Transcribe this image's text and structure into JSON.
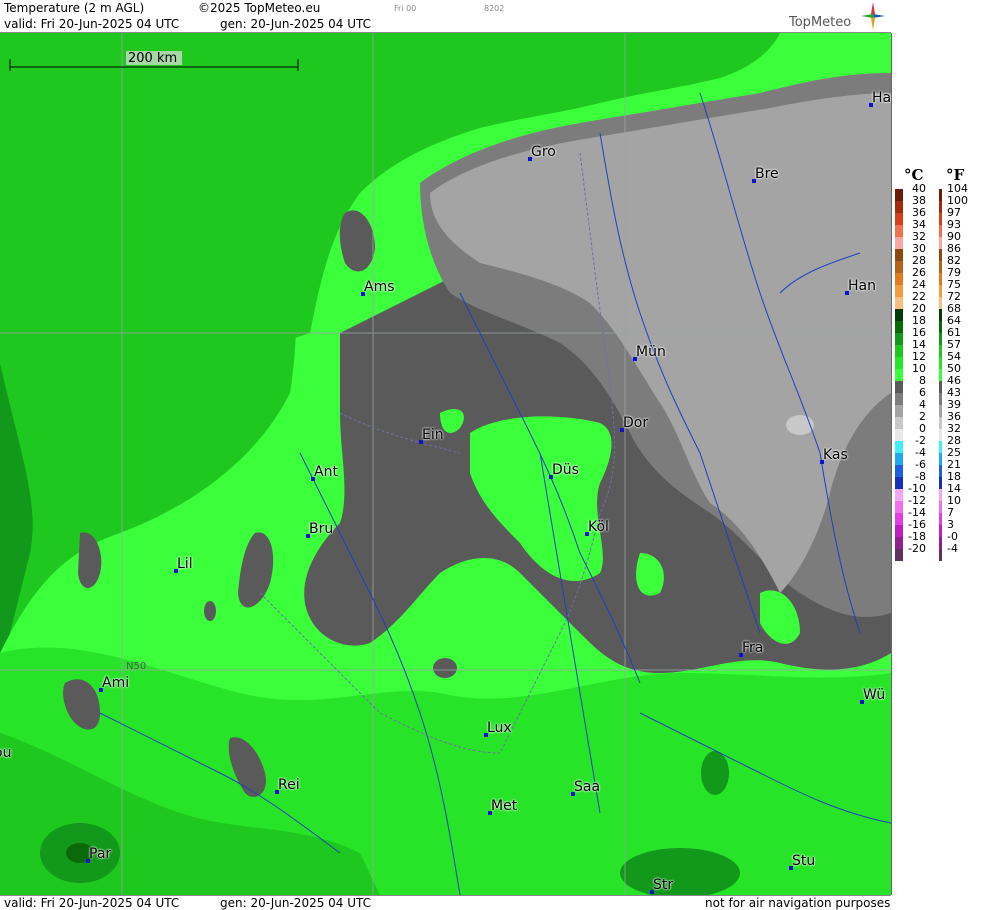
{
  "header": {
    "title": "Temperature (2 m AGL)",
    "copyright": "©2025 TopMeteo.eu",
    "run_code": "Fri 00",
    "run_id": "8202",
    "valid_label": "valid:  Fri  20-Jun-2025  04 UTC",
    "gen_label": "gen:  20-Jun-2025  04 UTC",
    "logo_text": "TopMeteo"
  },
  "footer": {
    "valid_label": "valid:  Fri  20-Jun-2025  04 UTC",
    "gen_label": "gen:  20-Jun-2025  04 UTC",
    "disclaimer": "not for air navigation purposes"
  },
  "map": {
    "scale_label": "200 km",
    "latitude_label": "N50",
    "cities": [
      {
        "name": "Ham"
      },
      {
        "name": "Gro"
      },
      {
        "name": "Bre"
      },
      {
        "name": "Ams"
      },
      {
        "name": "Han"
      },
      {
        "name": "Mün"
      },
      {
        "name": "Ein"
      },
      {
        "name": "Dor"
      },
      {
        "name": "Kas"
      },
      {
        "name": "Ant"
      },
      {
        "name": "Düs"
      },
      {
        "name": "Bru"
      },
      {
        "name": "Köl"
      },
      {
        "name": "Lil"
      },
      {
        "name": "Fra"
      },
      {
        "name": "Ami"
      },
      {
        "name": "Wü"
      },
      {
        "name": "Lux"
      },
      {
        "name": "Rei"
      },
      {
        "name": "Saa"
      },
      {
        "name": "Met"
      },
      {
        "name": "Par"
      },
      {
        "name": "Stu"
      },
      {
        "name": "Str"
      },
      {
        "name": "ou"
      }
    ]
  },
  "legend": {
    "unit_c": "°C",
    "unit_f": "°F",
    "entries": [
      {
        "c": "40",
        "f": "104",
        "color": "#6b1c05"
      },
      {
        "c": "38",
        "f": "100",
        "color": "#a32a0c"
      },
      {
        "c": "36",
        "f": "97",
        "color": "#d4401c"
      },
      {
        "c": "34",
        "f": "93",
        "color": "#f07050"
      },
      {
        "c": "32",
        "f": "90",
        "color": "#f8a8a0"
      },
      {
        "c": "30",
        "f": "86",
        "color": "#8b4a10"
      },
      {
        "c": "28",
        "f": "82",
        "color": "#b86418"
      },
      {
        "c": "26",
        "f": "79",
        "color": "#e07c20"
      },
      {
        "c": "24",
        "f": "75",
        "color": "#f49a40"
      },
      {
        "c": "22",
        "f": "72",
        "color": "#f8c080"
      },
      {
        "c": "20",
        "f": "68",
        "color": "#063a06"
      },
      {
        "c": "18",
        "f": "64",
        "color": "#0a6a0a"
      },
      {
        "c": "16",
        "f": "61",
        "color": "#12981a"
      },
      {
        "c": "14",
        "f": "57",
        "color": "#1ec81e"
      },
      {
        "c": "12",
        "f": "54",
        "color": "#28e428"
      },
      {
        "c": "10",
        "f": "50",
        "color": "#3cff3c"
      },
      {
        "c": "8",
        "f": "46",
        "color": "#5a5a5a"
      },
      {
        "c": "6",
        "f": "43",
        "color": "#7c7c7c"
      },
      {
        "c": "4",
        "f": "39",
        "color": "#a4a4a4"
      },
      {
        "c": "2",
        "f": "36",
        "color": "#c8c8c8"
      },
      {
        "c": "0",
        "f": "32",
        "color": "#e8e8e8"
      },
      {
        "c": "-2",
        "f": "28",
        "color": "#40f0f8"
      },
      {
        "c": "-4",
        "f": "25",
        "color": "#20a8f0"
      },
      {
        "c": "-6",
        "f": "21",
        "color": "#2060e0"
      },
      {
        "c": "-8",
        "f": "18",
        "color": "#1830b8"
      },
      {
        "c": "-10",
        "f": "14",
        "color": "#f4a8f4"
      },
      {
        "c": "-12",
        "f": "10",
        "color": "#f070f0"
      },
      {
        "c": "-14",
        "f": "7",
        "color": "#e040e0"
      },
      {
        "c": "-16",
        "f": "3",
        "color": "#c020c0"
      },
      {
        "c": "-18",
        "f": "-0",
        "color": "#902090"
      },
      {
        "c": "-20",
        "f": "-4",
        "color": "#603060"
      }
    ]
  },
  "colors": {
    "green_bright": "#3cff3c",
    "green_mid": "#28e428",
    "green_dark": "#1ec81e",
    "green_darker": "#12981a",
    "grey_dark": "#5a5a5a",
    "grey_mid": "#7c7c7c",
    "grey_light": "#a4a4a4",
    "grey_lighter": "#c8c8c8",
    "river": "#2040c0",
    "city_dot": "#1010d0"
  }
}
